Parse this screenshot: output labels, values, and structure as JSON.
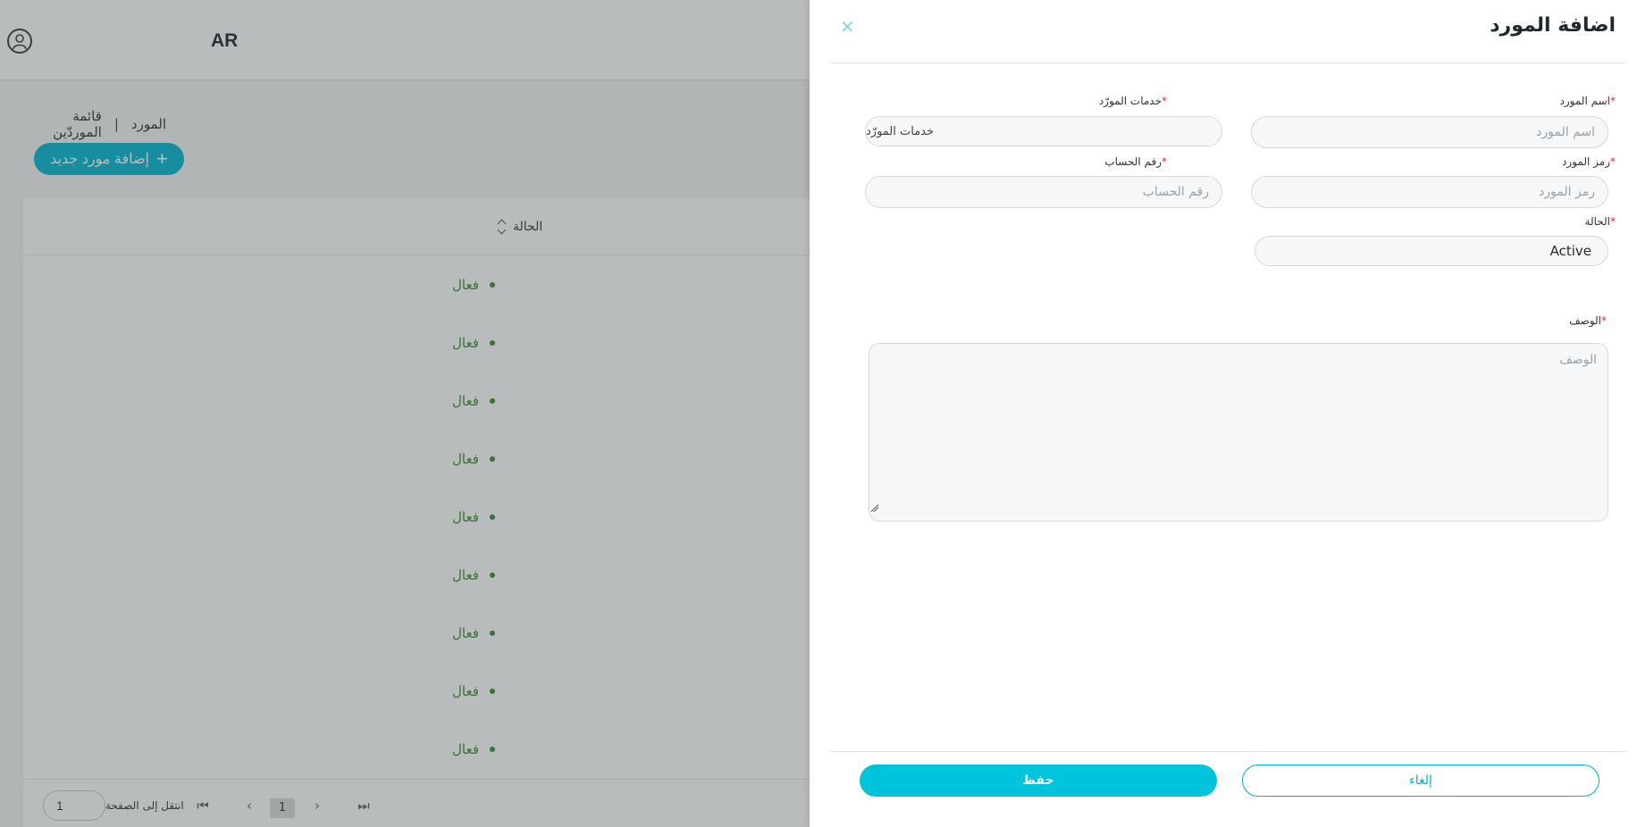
{
  "header": {
    "language": "AR"
  },
  "breadcrumb": {
    "parent": "المورد",
    "separator": "|",
    "current": "قائمة الموردّين"
  },
  "toolbar": {
    "add_label": "إضافة مورد جديد",
    "add_icon": "plus-icon"
  },
  "table": {
    "status_header": "الحالة",
    "rows": [
      {
        "status": "فعال"
      },
      {
        "status": "فعال"
      },
      {
        "status": "فعال"
      },
      {
        "status": "فعال"
      },
      {
        "status": "فعال"
      },
      {
        "status": "فعال"
      },
      {
        "status": "فعال"
      },
      {
        "status": "فعال"
      },
      {
        "status": "فعال"
      }
    ]
  },
  "pager": {
    "goto_label": "انتقل إلى الصفحة",
    "goto_value": "1",
    "current_page": "1"
  },
  "drawer": {
    "title": "اضافة المورد",
    "required_mark": "*",
    "fields": {
      "name": {
        "label": "اسم المورد",
        "placeholder": "اسم المورد"
      },
      "services": {
        "label": "خدمات المورّد",
        "value": "خدمات المورّد"
      },
      "code": {
        "label": "رمز المورد",
        "placeholder": "رمز المورد"
      },
      "account": {
        "label": "رقم الحساب",
        "placeholder": "رقم الحساب"
      },
      "status": {
        "label": "الحالة",
        "value": "Active"
      },
      "description": {
        "label": "الوصف",
        "placeholder": "الوصف"
      }
    },
    "actions": {
      "save": "حفظ",
      "cancel": "إلغاء"
    }
  },
  "colors": {
    "accent": "#00c3dc",
    "active_green": "#3c8c2f",
    "required": "#e0223f"
  }
}
